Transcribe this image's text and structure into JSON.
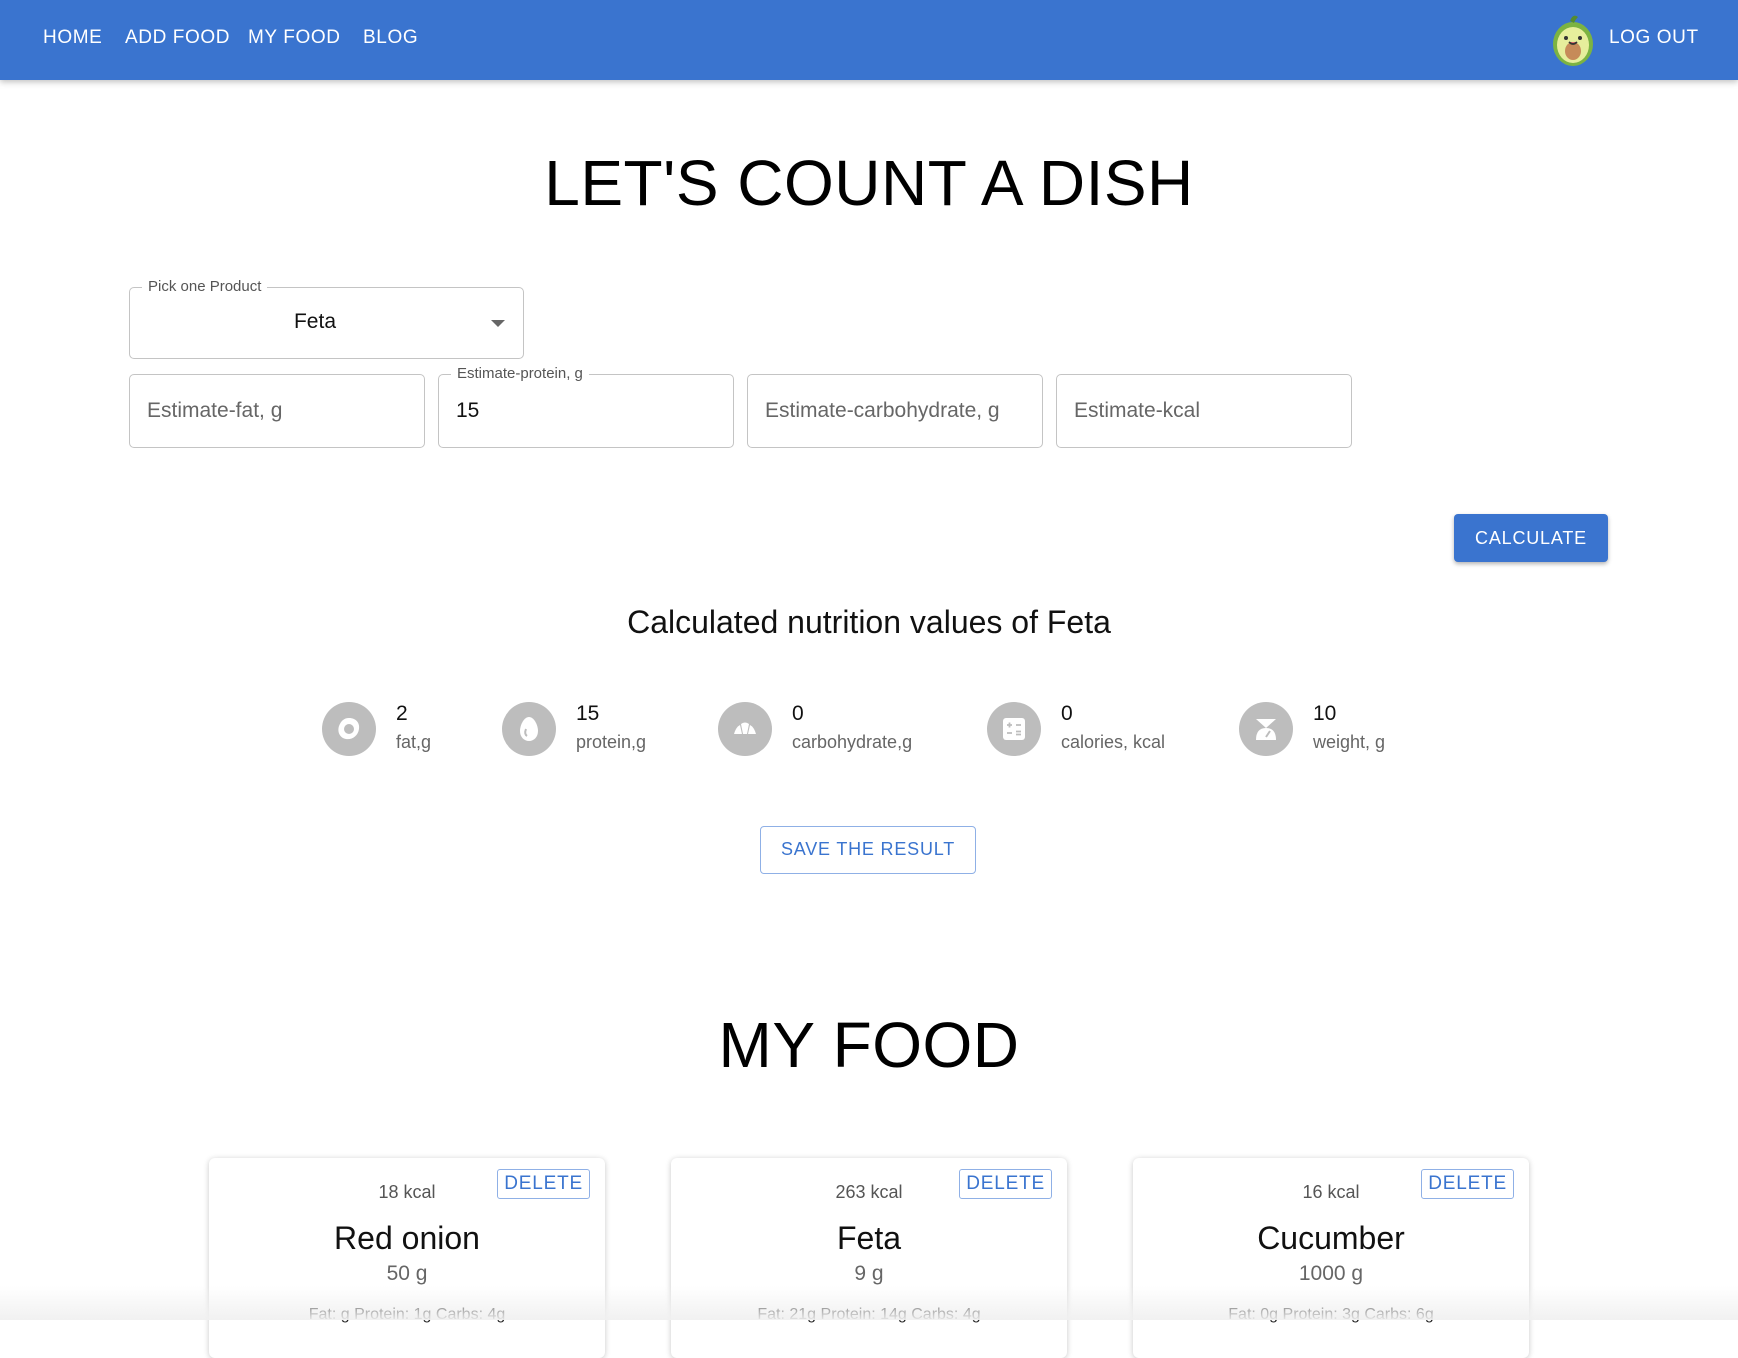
{
  "nav": {
    "home": "HOME",
    "add_food": "ADD FOOD",
    "my_food": "MY FOOD",
    "blog": "BLOG",
    "logout": "LOG OUT"
  },
  "calculator": {
    "title": "LET'S COUNT A DISH",
    "product_label": "Pick one Product",
    "product_value": "Feta",
    "fields": {
      "fat": {
        "placeholder": "Estimate-fat, g",
        "value": ""
      },
      "protein": {
        "label": "Estimate-protein, g",
        "placeholder": "Estimate-protein, g",
        "value": "15"
      },
      "carbs": {
        "placeholder": "Estimate-carbohydrate, g",
        "value": ""
      },
      "kcal": {
        "placeholder": "Estimate-kcal",
        "value": ""
      }
    },
    "calculate_label": "CALCULATE",
    "result_title": "Calculated nutrition values of Feta",
    "stats": [
      {
        "icon": "egg-fried-icon",
        "value": "2",
        "label": "fat,g"
      },
      {
        "icon": "egg-icon",
        "value": "15",
        "label": "protein,g"
      },
      {
        "icon": "croissant-icon",
        "value": "0",
        "label": "carbohydrate,g"
      },
      {
        "icon": "calculator-icon",
        "value": "0",
        "label": "calories, kcal"
      },
      {
        "icon": "scale-icon",
        "value": "10",
        "label": "weight, g"
      }
    ],
    "save_label": "SAVE THE RESULT"
  },
  "my_food": {
    "title": "MY FOOD",
    "delete_label": "DELETE",
    "cards": [
      {
        "kcal": "18 kcal",
        "name": "Red onion",
        "weight": "50 g",
        "macros": "Fat: g Protein: 1g Carbs: 4g"
      },
      {
        "kcal": "263 kcal",
        "name": "Feta",
        "weight": "9 g",
        "macros": "Fat: 21g Protein: 14g Carbs: 4g"
      },
      {
        "kcal": "16 kcal",
        "name": "Cucumber",
        "weight": "1000 g",
        "macros": "Fat: 0g Protein: 3g Carbs: 6g"
      }
    ]
  },
  "colors": {
    "primary": "#3a74cf",
    "icon_bg": "#bdbdbd"
  }
}
